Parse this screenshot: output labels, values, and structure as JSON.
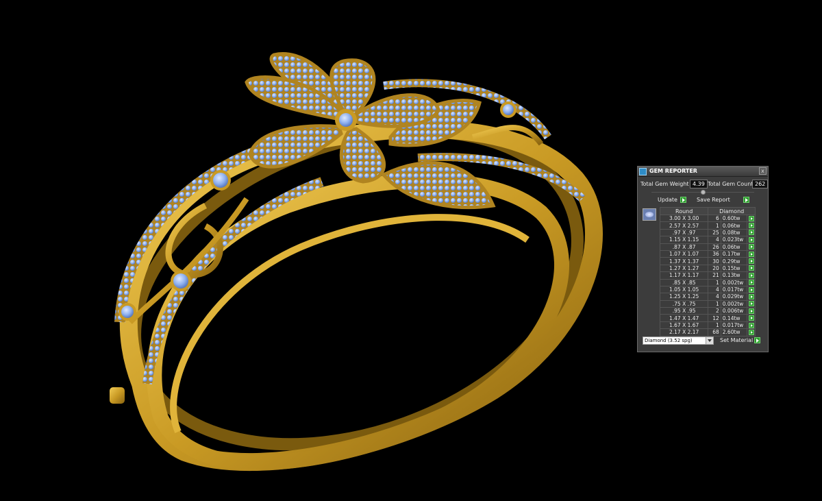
{
  "panel": {
    "title": "GEM REPORTER",
    "close_glyph": "x",
    "total_weight_label": "Total Gem Weight",
    "total_weight_value": "4.39",
    "total_count_label": "Total Gem Count",
    "total_count_value": "262",
    "update_label": "Update",
    "save_report_label": "Save Report",
    "table": {
      "shape_header": "Round",
      "material_header": "Diamond",
      "rows": [
        {
          "size": "3.00 X 3.00",
          "count": "6",
          "weight": "0.60tw"
        },
        {
          "size": "2.57 X 2.57",
          "count": "1",
          "weight": "0.06tw"
        },
        {
          "size": ".97 X .97",
          "count": "25",
          "weight": "0.08tw"
        },
        {
          "size": "1.15 X 1.15",
          "count": "4",
          "weight": "0.023tw"
        },
        {
          "size": ".87 X .87",
          "count": "26",
          "weight": "0.06tw"
        },
        {
          "size": "1.07 X 1.07",
          "count": "36",
          "weight": "0.17tw"
        },
        {
          "size": "1.37 X 1.37",
          "count": "30",
          "weight": "0.29tw"
        },
        {
          "size": "1.27 X 1.27",
          "count": "20",
          "weight": "0.15tw"
        },
        {
          "size": "1.17 X 1.17",
          "count": "21",
          "weight": "0.13tw"
        },
        {
          "size": ".85 X .85",
          "count": "1",
          "weight": "0.002tw"
        },
        {
          "size": "1.05 X 1.05",
          "count": "4",
          "weight": "0.017tw"
        },
        {
          "size": "1.25 X 1.25",
          "count": "4",
          "weight": "0.029tw"
        },
        {
          "size": ".75 X .75",
          "count": "1",
          "weight": "0.002tw"
        },
        {
          "size": ".95 X .95",
          "count": "2",
          "weight": "0.006tw"
        },
        {
          "size": "1.47 X 1.47",
          "count": "12",
          "weight": "0.14tw"
        },
        {
          "size": "1.67 X 1.67",
          "count": "1",
          "weight": "0.017tw"
        },
        {
          "size": "2.17 X 2.17",
          "count": "68",
          "weight": "2.60tw"
        }
      ]
    },
    "material_select_value": "Diamond    (3.52 spg)",
    "set_material_label": "Set Material"
  },
  "colors": {
    "background": "#000000",
    "gold": "#c99a24",
    "gem": "#8fb1ef",
    "panel": "#3c3c3c",
    "accent_green": "#2e9c2e"
  },
  "icons": [
    "gem-reporter-app-icon",
    "close-icon",
    "play-arrow-icon",
    "gem-thumbnail-icon",
    "chevron-down-icon"
  ]
}
